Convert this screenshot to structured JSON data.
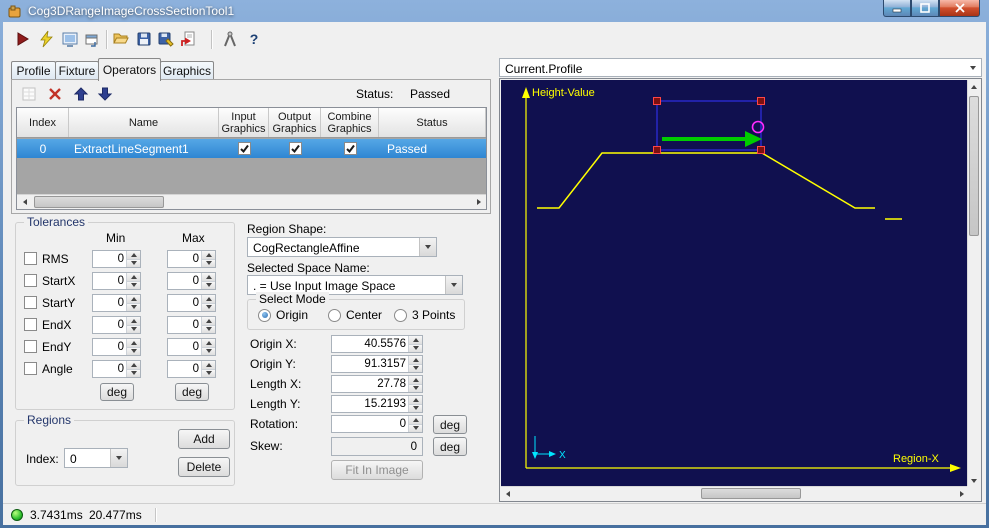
{
  "window": {
    "title": "Cog3DRangeImageCrossSectionTool1",
    "controls": [
      "minimize",
      "maximize",
      "close"
    ]
  },
  "toolbar": {
    "icons": [
      "run",
      "live-run",
      "image-display",
      "float-window",
      "open",
      "save",
      "save-as",
      "import",
      "measure",
      "help"
    ]
  },
  "tabs": {
    "items": [
      {
        "label": "Profile",
        "selected": false
      },
      {
        "label": "Fixture",
        "selected": false
      },
      {
        "label": "Operators",
        "selected": true
      },
      {
        "label": "Graphics",
        "selected": false
      }
    ]
  },
  "operators": {
    "status_label": "Status:",
    "status_value": "Passed",
    "table": {
      "columns": [
        "Index",
        "Name",
        "Input Graphics",
        "Output Graphics",
        "Combine Graphics",
        "Status"
      ],
      "rows": [
        {
          "index": "0",
          "name": "ExtractLineSegment1",
          "input_graphics": true,
          "output_graphics": true,
          "combine_graphics": true,
          "status": "Passed"
        }
      ]
    }
  },
  "tolerances": {
    "title": "Tolerances",
    "min_header": "Min",
    "max_header": "Max",
    "rows": [
      {
        "label": "RMS",
        "min": "0",
        "max": "0",
        "checked": false
      },
      {
        "label": "StartX",
        "min": "0",
        "max": "0",
        "checked": false
      },
      {
        "label": "StartY",
        "min": "0",
        "max": "0",
        "checked": false
      },
      {
        "label": "EndX",
        "min": "0",
        "max": "0",
        "checked": false
      },
      {
        "label": "EndY",
        "min": "0",
        "max": "0",
        "checked": false
      },
      {
        "label": "Angle",
        "min": "0",
        "max": "0",
        "checked": false
      }
    ],
    "min_unit": "deg",
    "max_unit": "deg"
  },
  "regions": {
    "title": "Regions",
    "index_label": "Index:",
    "index_value": "0",
    "add_label": "Add",
    "delete_label": "Delete"
  },
  "region_editor": {
    "shape_label": "Region Shape:",
    "shape_value": "CogRectangleAffine",
    "space_label": "Selected Space Name:",
    "space_value": ". = Use Input Image Space",
    "mode_label": "Select Mode",
    "modes": [
      {
        "label": "Origin",
        "selected": true
      },
      {
        "label": "Center",
        "selected": false
      },
      {
        "label": "3 Points",
        "selected": false
      }
    ],
    "fields": [
      {
        "label": "Origin X:",
        "value": "40.5576"
      },
      {
        "label": "Origin Y:",
        "value": "91.3157"
      },
      {
        "label": "Length X:",
        "value": "27.78"
      },
      {
        "label": "Length Y:",
        "value": "15.2193"
      },
      {
        "label": "Rotation:",
        "value": "0",
        "unit": "deg"
      },
      {
        "label": "Skew:",
        "value": "0",
        "unit": "deg"
      }
    ],
    "fit_button_label": "Fit In Image"
  },
  "display": {
    "profile_selector": "Current.Profile",
    "y_axis_label": "Height-Value",
    "x_axis_label": "Region-X",
    "origin_marker_label": "X",
    "colors": {
      "background": "#10104f",
      "profile": "#ffff00",
      "region": "#2a2ace",
      "handles": "#7d1010",
      "arrow": "#00cc00",
      "rotation_handle": "#ff2bff"
    }
  },
  "status_bar": {
    "run_time": "3.7431ms",
    "total_time": "20.477ms"
  }
}
